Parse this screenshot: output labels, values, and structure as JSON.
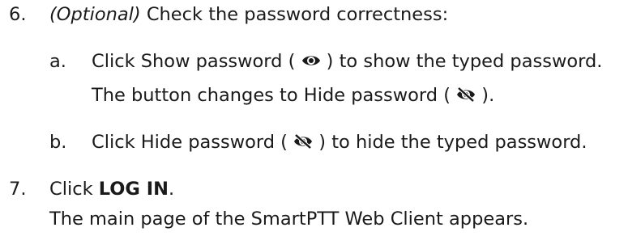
{
  "steps": [
    {
      "number": "6.",
      "optional_label": "(Optional)",
      "text": " Check the password correctness:",
      "substeps": [
        {
          "letter": "a.",
          "prefix": "Click Show password ( ",
          "icon": "eye-icon",
          "suffix": " ) to show the typed password.",
          "result_prefix": "The button changes to Hide password ( ",
          "result_icon": "eye-slash-icon",
          "result_suffix": " )."
        },
        {
          "letter": "b.",
          "prefix": "Click Hide password ( ",
          "icon": "eye-slash-icon",
          "suffix": " ) to hide the typed password."
        }
      ]
    },
    {
      "number": "7.",
      "prefix": "Click ",
      "strong": "LOG IN",
      "suffix": ".",
      "result": "The main page of the SmartPTT Web Client appears."
    }
  ],
  "colors": {
    "text": "#1a1a1a",
    "background": "#ffffff"
  }
}
